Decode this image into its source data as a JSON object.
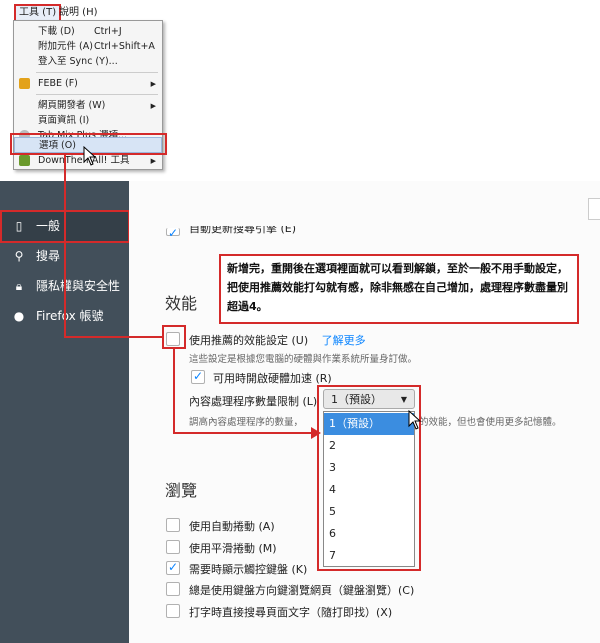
{
  "menubar": {
    "tools": "工具 (T)",
    "help": "說明 (H)"
  },
  "tools_menu": {
    "items": [
      {
        "label": "下載 (D)",
        "shortcut": "Ctrl+J"
      },
      {
        "label": "附加元件 (A)",
        "shortcut": "Ctrl+Shift+A"
      },
      {
        "label": "登入至 Sync (Y)..."
      },
      {
        "label": "FEBE (F)",
        "submenu": true
      },
      {
        "label": "網頁開發者 (W)",
        "submenu": true
      },
      {
        "label": "頁面資訊 (I)"
      },
      {
        "label": "Tab Mix Plus 選項..."
      },
      {
        "label": "選項 (O)"
      },
      {
        "label": "DownThemAll! 工具",
        "submenu": true
      }
    ]
  },
  "sidebar": {
    "items": [
      {
        "label": "一般",
        "icon": "page-icon"
      },
      {
        "label": "搜尋",
        "icon": "search-icon"
      },
      {
        "label": "隱私權與安全性",
        "icon": "lock-icon"
      },
      {
        "label": "Firefox 帳號",
        "icon": "user-icon"
      }
    ]
  },
  "content": {
    "top_cutoff_label": "自動更新搜尋引擎 (E)",
    "performance": {
      "heading": "效能",
      "recommended_label": "使用推薦的效能設定 (U)",
      "learn_more": "了解更多",
      "recommended_note": "這些設定是根據您電腦的硬體與作業系統所量身訂做。",
      "hw_accel_label": "可用時開啟硬體加速 (R)",
      "process_limit_label": "內容處理程序數量限制 (L)",
      "process_note_left": "調高內容處理程序的數量，",
      "process_note_right": "的效能，但也會使用更多記憶體。",
      "select_value": "1（預設）",
      "options": [
        "1（預設）",
        "2",
        "3",
        "4",
        "5",
        "6",
        "7"
      ]
    },
    "browsing": {
      "heading": "瀏覽",
      "options": [
        {
          "label": "使用自動捲動 (A)",
          "checked": false
        },
        {
          "label": "使用平滑捲動 (M)",
          "checked": false
        },
        {
          "label": "需要時顯示觸控鍵盤 (K)",
          "checked": true
        },
        {
          "label": "總是使用鍵盤方向鍵瀏覽網頁（鍵盤瀏覽）(C)",
          "checked": false
        },
        {
          "label": "打字時直接搜尋頁面文字（隨打即找）(X)",
          "checked": false
        }
      ]
    }
  },
  "annotation": {
    "text": "新增完，重開後在選項裡面就可以看到解鎖，至於一般不用手動設定，把使用推薦效能打勾就有感，除非無感在自己增加，處理程序數盡量別超過4。"
  },
  "colors": {
    "accent": "#0a84ff",
    "annotation_red": "#d42a2a",
    "sidebar_bg": "#424f5a"
  }
}
